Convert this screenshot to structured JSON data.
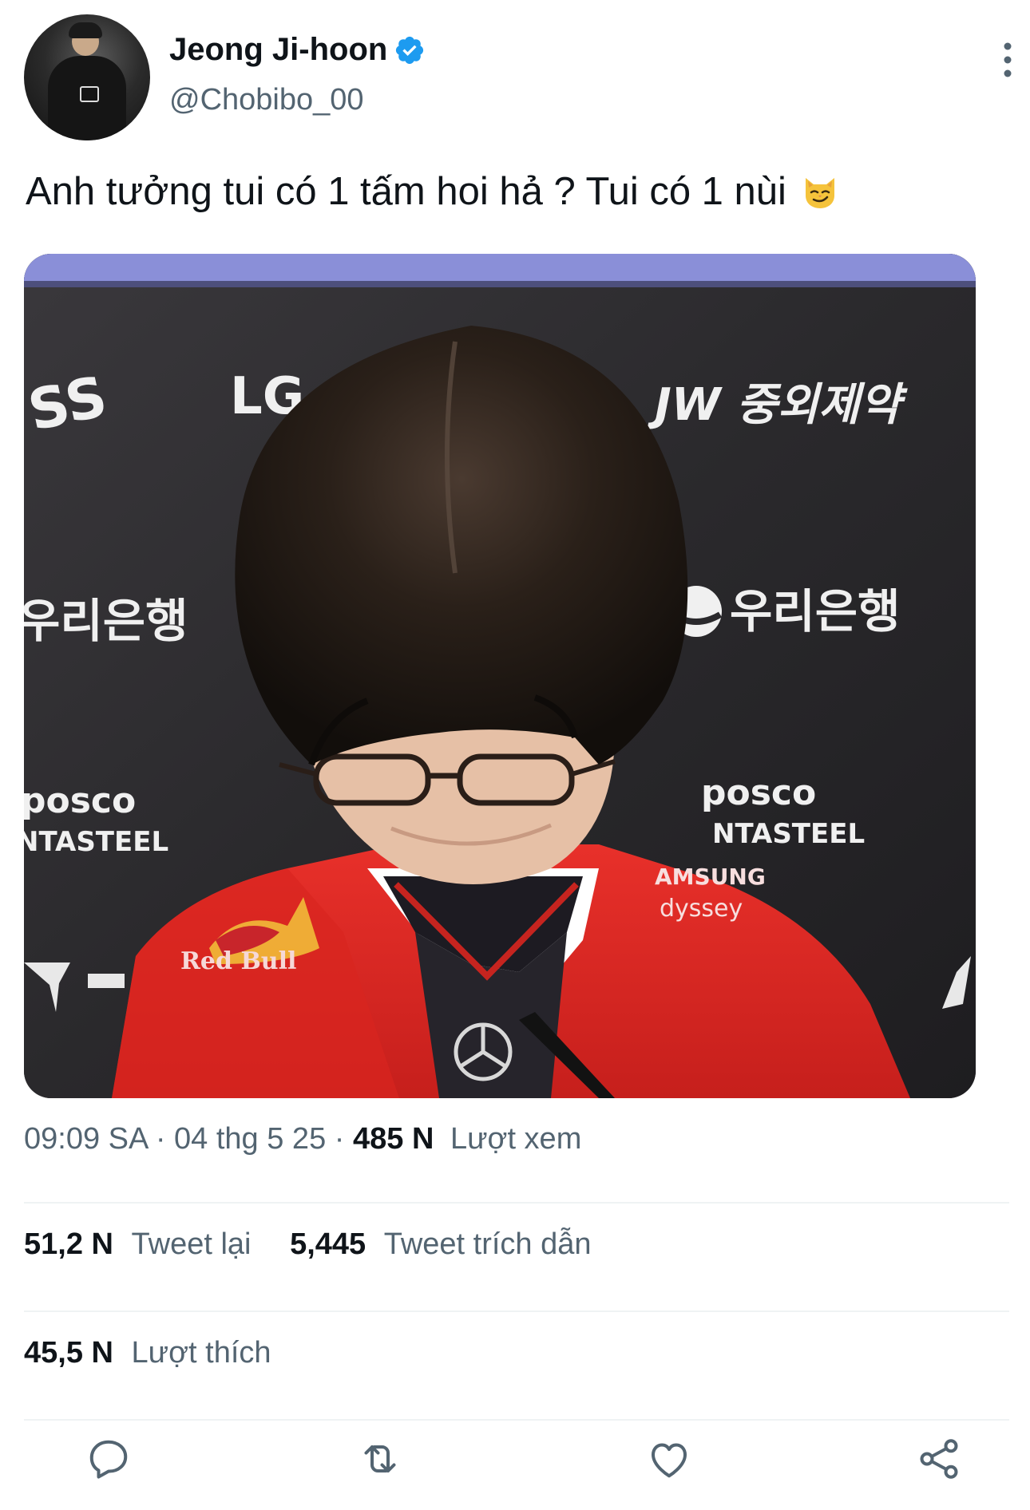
{
  "author": {
    "display_name": "Jeong Ji-hoon",
    "handle": "@Chobibo_00",
    "verified": true
  },
  "tweet": {
    "text": "Anh tưởng tui có 1 tấm hoi hả ? Tui có 1 nùi",
    "emoji": "smirking-cat-emoji"
  },
  "media": {
    "sponsor_labels": [
      "SS",
      "LG",
      "JW 중외제약",
      "우리은행",
      "우리은행",
      "posco",
      "NTASTEEL",
      "posco",
      "NTASTEEL",
      "AMSUNG",
      "dyssey",
      "Red Bull"
    ]
  },
  "meta": {
    "time": "09:09 SA",
    "sep1": "·",
    "date": "04 thg 5 25",
    "sep2": "·",
    "views_count": "485 N",
    "views_label": "Lượt xem"
  },
  "stats": {
    "retweets_count": "51,2 N",
    "retweets_label": "Tweet lại",
    "quotes_count": "5,445",
    "quotes_label": "Tweet trích dẫn",
    "likes_count": "45,5 N",
    "likes_label": "Lượt thích"
  },
  "colors": {
    "verified_blue": "#1d9bf0",
    "text_primary": "#0f1419",
    "text_secondary": "#536471",
    "divider": "#eff3f4"
  },
  "actions": [
    "reply-icon",
    "retweet-icon",
    "like-icon",
    "share-icon"
  ]
}
